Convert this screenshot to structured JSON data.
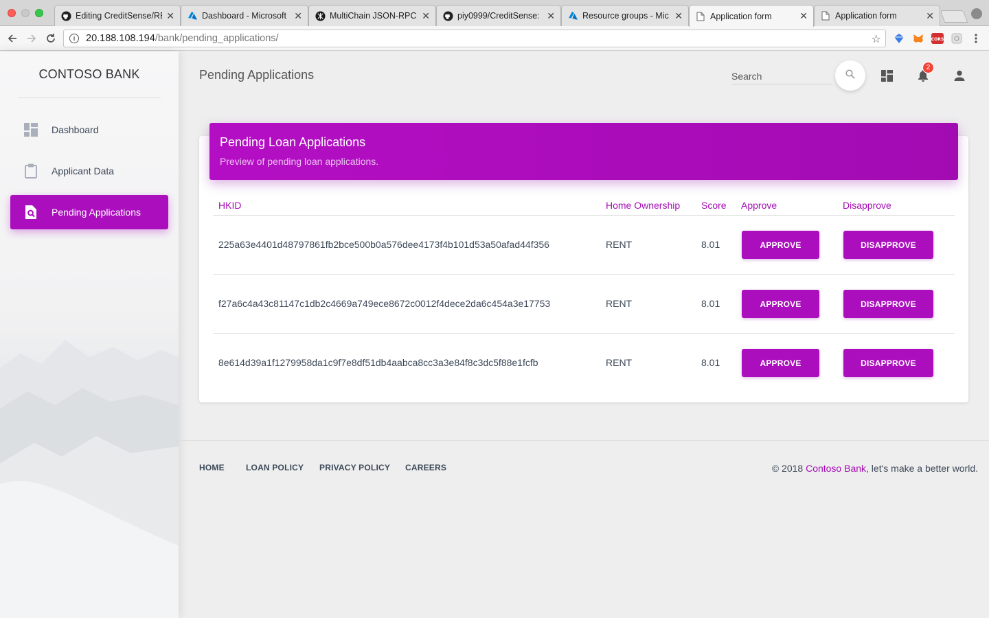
{
  "browser": {
    "tabs": [
      {
        "title": "Editing CreditSense/RE",
        "favicon": "github-icon"
      },
      {
        "title": "Dashboard - Microsoft",
        "favicon": "azure-icon"
      },
      {
        "title": "MultiChain JSON-RPC",
        "favicon": "multichain-icon"
      },
      {
        "title": "piy0999/CreditSense:",
        "favicon": "github-icon"
      },
      {
        "title": "Resource groups - Mic",
        "favicon": "azure-icon"
      },
      {
        "title": "Application form",
        "favicon": "page-icon",
        "active": true
      },
      {
        "title": "Application form",
        "favicon": "page-icon"
      }
    ],
    "url_host": "20.188.108.194",
    "url_path": "/bank/pending_applications/"
  },
  "sidebar": {
    "brand": "CONTOSO BANK",
    "items": [
      {
        "label": "Dashboard",
        "icon": "dashboard-icon"
      },
      {
        "label": "Applicant Data",
        "icon": "clipboard-icon"
      },
      {
        "label": "Pending Applications",
        "icon": "search-file-icon",
        "active": true
      }
    ]
  },
  "topbar": {
    "title": "Pending Applications",
    "search_placeholder": "Search",
    "notifications_count": "2"
  },
  "card": {
    "title": "Pending Loan Applications",
    "subtitle": "Preview of pending loan applications."
  },
  "table": {
    "headers": {
      "hkid": "HKID",
      "ownership": "Home Ownership",
      "score": "Score",
      "approve": "Approve",
      "disapprove": "Disapprove"
    },
    "rows": [
      {
        "hkid": "225a63e4401d48797861fb2bce500b0a576dee4173f4b101d53a50afad44f356",
        "ownership": "RENT",
        "score": "8.01",
        "approve": "APPROVE",
        "disapprove": "DISAPPROVE"
      },
      {
        "hkid": "f27a6c4a43c81147c1db2c4669a749ece8672c0012f4dece2da6c454a3e17753",
        "ownership": "RENT",
        "score": "8.01",
        "approve": "APPROVE",
        "disapprove": "DISAPPROVE"
      },
      {
        "hkid": "8e614d39a1f1279958da1c9f7e8df51db4aabca8cc3a3e84f8c3dc5f88e1fcfb",
        "ownership": "RENT",
        "score": "8.01",
        "approve": "APPROVE",
        "disapprove": "DISAPPROVE"
      }
    ]
  },
  "footer": {
    "links": [
      "HOME",
      "LOAN POLICY",
      "PRIVACY POLICY",
      "CAREERS"
    ],
    "copy_prefix": "© 2018 ",
    "copy_brand": "Contoso Bank",
    "copy_suffix": ", let's make a better world."
  },
  "colors": {
    "accent": "#ab0fbd",
    "header_text": "#a40bb4",
    "badge": "#f44336"
  }
}
